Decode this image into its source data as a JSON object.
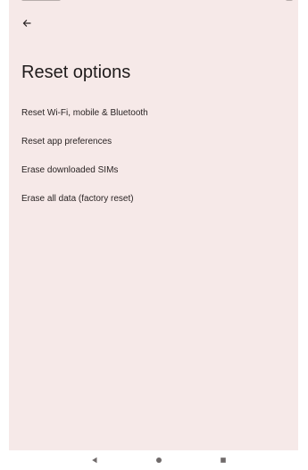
{
  "header": {
    "back_icon": "arrow-back-icon",
    "title": "Reset options"
  },
  "options": [
    {
      "label": "Reset Wi-Fi, mobile & Bluetooth"
    },
    {
      "label": "Reset app preferences"
    },
    {
      "label": "Erase downloaded SIMs"
    },
    {
      "label": "Erase all data (factory reset)"
    }
  ],
  "nav_bar": {
    "back_icon": "triangle-back-icon",
    "home_icon": "circle-home-icon",
    "recents_icon": "square-recents-icon"
  },
  "colors": {
    "background": "#f6e9e8",
    "text_primary": "#1f1b1b",
    "nav_icon": "#6f6a6a"
  }
}
